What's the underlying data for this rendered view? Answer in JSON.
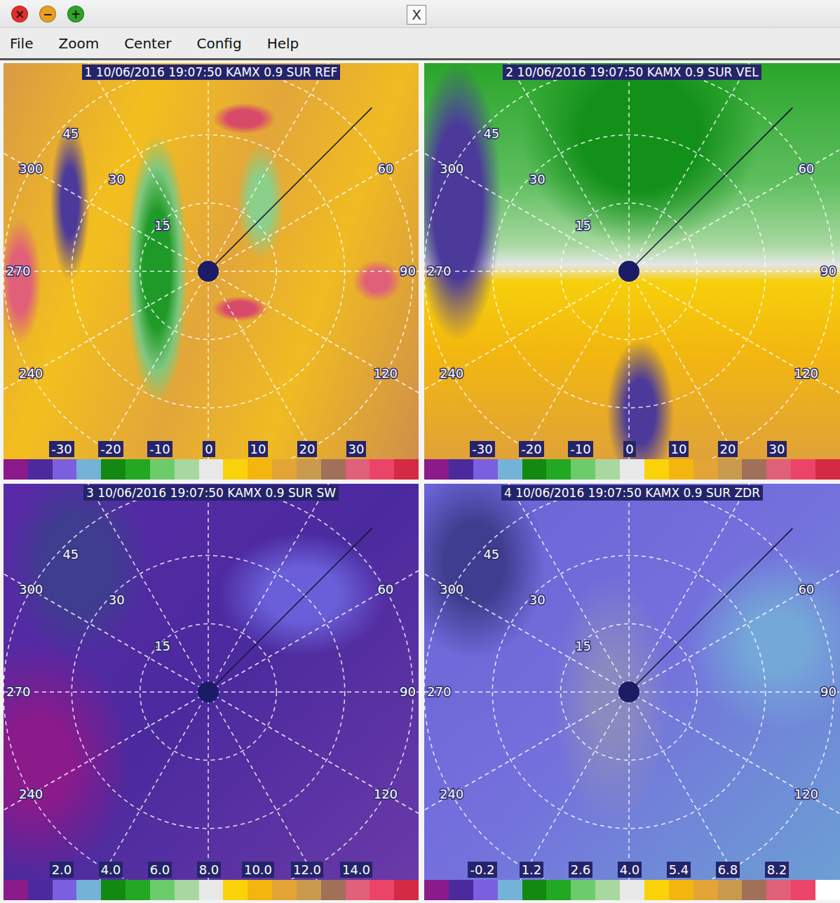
{
  "window": {
    "controls": [
      {
        "glyph": "×",
        "color": "#e0302c"
      },
      {
        "glyph": "−",
        "color": "#e8a020"
      },
      {
        "glyph": "+",
        "color": "#2aa52a"
      }
    ],
    "logo": "X"
  },
  "menu": [
    "File",
    "Zoom",
    "Center",
    "Config",
    "Help"
  ],
  "panels": [
    {
      "title": "1 10/06/2016 19:07:50 KAMX 0.9 SUR REF",
      "kind": "reflectivity",
      "range_labels": [
        "15",
        "30",
        "45"
      ],
      "azimuth_labels": [
        "300",
        "270",
        "240",
        "60",
        "90",
        "120"
      ],
      "legend": {
        "labels": [
          "-30",
          "-20",
          "-10",
          "0",
          "10",
          "20",
          "30"
        ],
        "swatches": [
          "#8b1a8b",
          "#4b2a9e",
          "#7a5fe0",
          "#74b2d8",
          "#128a12",
          "#22a822",
          "#6ccc6c",
          "#a8d8a0",
          "#e8e8e8",
          "#fad20a",
          "#f5b50f",
          "#e2a535",
          "#c99a4c",
          "#a07058",
          "#e0607a",
          "#ec4468",
          "#d42a44"
        ]
      }
    },
    {
      "title": "2 10/06/2016 19:07:50 KAMX 0.9 SUR VEL",
      "kind": "velocity",
      "range_labels": [
        "15",
        "30",
        "45"
      ],
      "azimuth_labels": [
        "300",
        "270",
        "240",
        "60",
        "90",
        "120"
      ],
      "legend": {
        "labels": [
          "-30",
          "-20",
          "-10",
          "0",
          "10",
          "20",
          "30"
        ],
        "swatches": [
          "#8b1a8b",
          "#4b2a9e",
          "#7a5fe0",
          "#74b2d8",
          "#128a12",
          "#22a822",
          "#6ccc6c",
          "#a8d8a0",
          "#e8e8e8",
          "#fad20a",
          "#f5b50f",
          "#e2a535",
          "#c99a4c",
          "#a07058",
          "#e0607a",
          "#ec4468",
          "#d42a44"
        ]
      }
    },
    {
      "title": "3 10/06/2016 19:07:50 KAMX 0.9 SUR SW",
      "kind": "width",
      "range_labels": [
        "15",
        "30",
        "45"
      ],
      "azimuth_labels": [
        "300",
        "270",
        "240",
        "60",
        "90",
        "120"
      ],
      "legend": {
        "labels": [
          "2.0",
          "4.0",
          "6.0",
          "8.0",
          "10.0",
          "12.0",
          "14.0"
        ],
        "swatches": [
          "#8b1a8b",
          "#4b2a9e",
          "#7a5fe0",
          "#74b2d8",
          "#128a12",
          "#22a822",
          "#6ccc6c",
          "#a8d8a0",
          "#e8e8e8",
          "#fad20a",
          "#f5b50f",
          "#e2a535",
          "#c99a4c",
          "#a07058",
          "#e0607a",
          "#ec4468",
          "#d42a44"
        ]
      }
    },
    {
      "title": "4 10/06/2016 19:07:50 KAMX 0.9 SUR ZDR",
      "kind": "differential",
      "range_labels": [
        "15",
        "30",
        "45"
      ],
      "azimuth_labels": [
        "300",
        "270",
        "240",
        "60",
        "90",
        "120"
      ],
      "legend": {
        "labels": [
          "-0.2",
          "1.2",
          "2.6",
          "4.0",
          "5.4",
          "6.8",
          "8.2"
        ],
        "swatches": [
          "#8b1a8b",
          "#4b2a9e",
          "#7a5fe0",
          "#74b2d8",
          "#128a12",
          "#22a822",
          "#6ccc6c",
          "#a8d8a0",
          "#e8e8e8",
          "#fad20a",
          "#f5b50f",
          "#e2a535",
          "#c99a4c",
          "#a07058",
          "#e0607a",
          "#ec4468",
          "#ffffff"
        ]
      }
    }
  ]
}
